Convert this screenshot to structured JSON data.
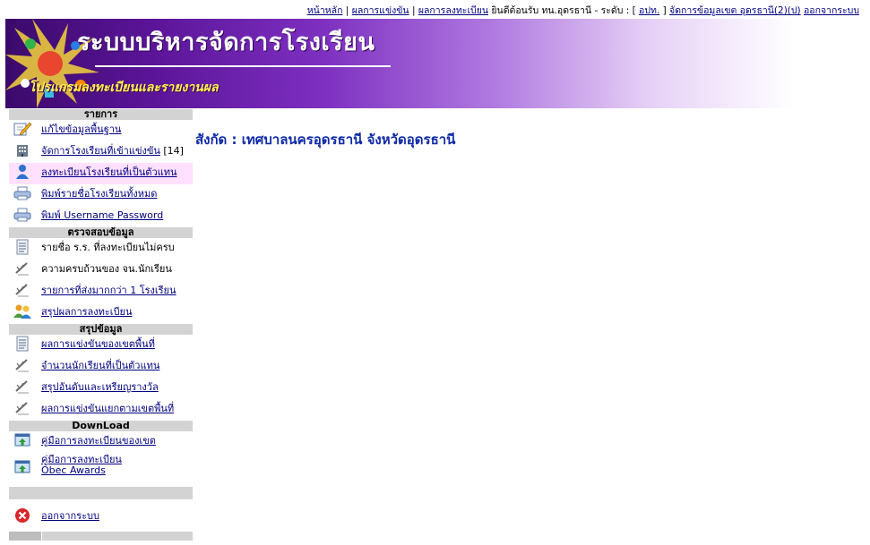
{
  "topnav": {
    "home": "หน้าหลัก",
    "sep1": " | ",
    "results": "ผลการแข่งขัน",
    "sep2": " | ",
    "register_results": "ผลการลงทะเบียน",
    "welcome": " ยินดีต้อนรับ ทน.อุดรธานี - ระดับ : [ ",
    "level_link": "อปท.",
    "bracket_close": " ] ",
    "manage_area": "จัดการข้อมูลเขต อุดรธานี(2)(ป)",
    "space": " ",
    "logout": "ออกจากระบบ"
  },
  "banner": {
    "title": "ระบบบริหารจัดการโรงเรียน",
    "subtitle": "โปรแกรมลงทะเบียนและรายงานผล"
  },
  "menu": {
    "sections": [
      {
        "header": "รายการ",
        "items": [
          {
            "label": "แก้ไขข้อมูลพื้นฐาน",
            "icon": "edit-pencil-icon",
            "link": true
          },
          {
            "label": "จัดการโรงเรียนที่เข้าแข่งขัน",
            "suffix": " [14]",
            "icon": "building-grid-icon",
            "link": true
          },
          {
            "label": "ลงทะเบียนโรงเรียนที่เป็นตัวแทน",
            "icon": "user-register-icon",
            "link": true,
            "highlight": true
          },
          {
            "label": "พิมพ์รายชื่อโรงเรียนทั้งหมด",
            "icon": "printer-icon",
            "link": true
          },
          {
            "label": "พิมพ์ Username Password",
            "icon": "printer-icon",
            "link": true
          }
        ]
      },
      {
        "header": "ตรวจสอบข้อมูล",
        "items": [
          {
            "label": "รายชื่อ ร.ร. ที่ลงทะเบียนไม่ครบ",
            "icon": "document-list-icon",
            "link": false
          },
          {
            "label": "ความครบถ้วนของ จน.นักเรียน",
            "icon": "pencil-check-icon",
            "link": false
          },
          {
            "label": "รายการที่ส่งมากกว่า 1 โรงเรียน",
            "icon": "pencil-check-icon",
            "link": true
          },
          {
            "label": "สรุปผลการลงทะเบียน",
            "icon": "users-summary-icon",
            "link": true
          }
        ]
      },
      {
        "header": "สรุปข้อมูล",
        "items": [
          {
            "label": "ผลการแข่งขันของเขตพื้นที่",
            "icon": "document-list-icon",
            "link": true
          },
          {
            "label": "จำนวนนักเรียนที่เป็นตัวแทน",
            "icon": "pencil-check-icon",
            "link": true
          },
          {
            "label": "สรุปอันดับและเหรียญรางวัล",
            "icon": "pencil-check-icon",
            "link": true
          },
          {
            "label": "ผลการแข่งขันแยกตามเขตพื้นที่",
            "icon": "pencil-check-icon",
            "link": true
          }
        ]
      },
      {
        "header": "DownLoad",
        "items": [
          {
            "label": "คู่มือการลงทะเบียนของเขต",
            "icon": "download-window-icon",
            "link": true
          },
          {
            "label": "คู่มือการลงทะเบียน Obec Awards",
            "icon": "download-window-icon",
            "link": true
          }
        ]
      }
    ],
    "logout": {
      "label": "ออกจากระบบ",
      "icon": "close-circle-icon"
    }
  },
  "main": {
    "heading": "สังกัด : เทศบาลนครอุดรธานี จังหวัดอุดรธานี"
  },
  "colors": {
    "link": "#000080",
    "heading": "#0f2aa8",
    "section_bg": "#d3d3d3",
    "highlight_bg": "#ffe0ff",
    "banner_dark": "#3b0a6b",
    "subtitle": "#fff34a"
  }
}
